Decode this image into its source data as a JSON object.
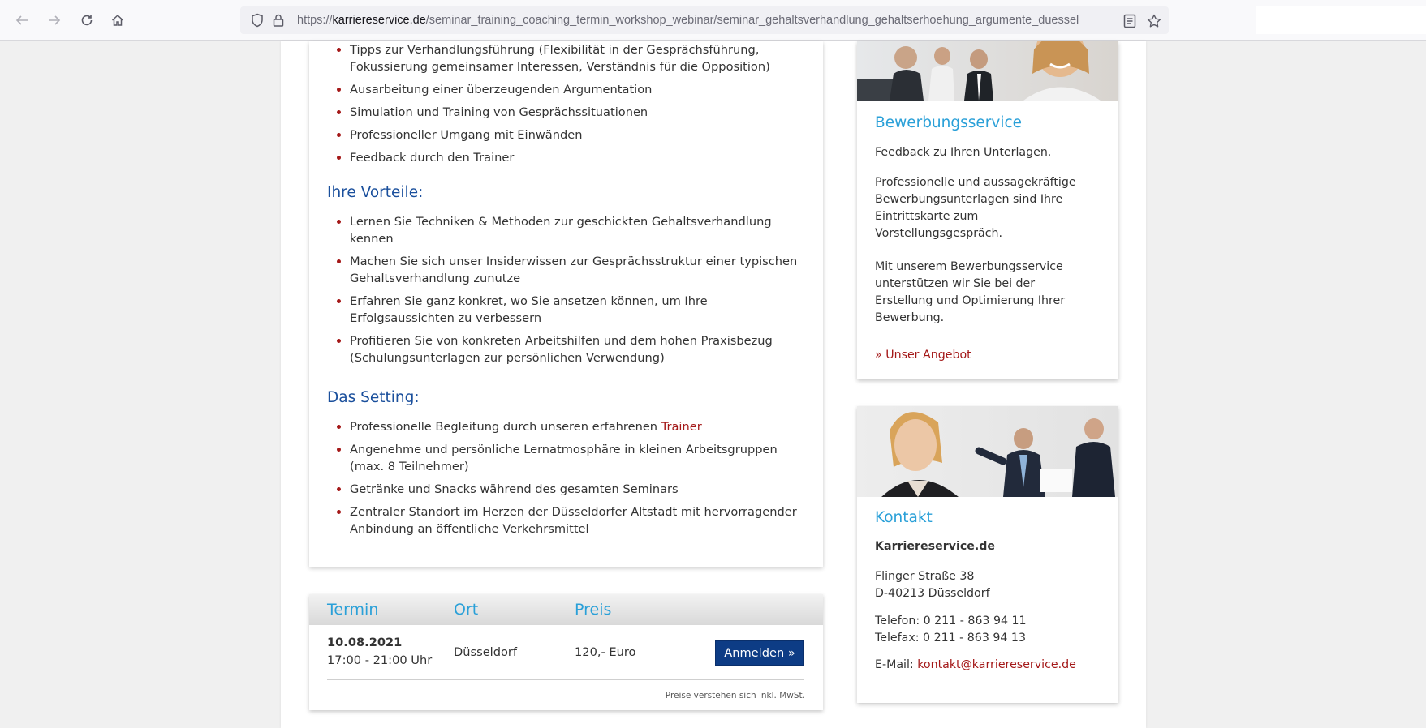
{
  "browser": {
    "url_prefix": "https://",
    "url_domain": "karriereservice.de",
    "url_path": "/seminar_training_coaching_termin_workshop_webinar/seminar_gehaltsverhandlung_gehaltserhoehung_argumente_duessel"
  },
  "main": {
    "intro_items": [
      {
        "line1": "Tipps zur Verhandlungsführung (Flexibilität in der Gesprächsführung,",
        "line2": "Fokussierung gemeinsamer Interessen, Verständnis für die Opposition)"
      },
      {
        "line1": "Ausarbeitung einer überzeugenden Argumentation"
      },
      {
        "line1": "Simulation und Training von Gesprächssituationen"
      },
      {
        "line1": "Professioneller Umgang mit Einwänden"
      },
      {
        "line1": "Feedback durch den Trainer"
      }
    ],
    "vorteile_heading": "Ihre Vorteile:",
    "vorteile_items": [
      {
        "line1": "Lernen Sie Techniken & Methoden zur geschickten Gehaltsverhandlung",
        "line2": "kennen"
      },
      {
        "line1": "Machen Sie sich unser Insiderwissen zur Gesprächsstruktur einer typischen",
        "line2": "Gehaltsverhandlung zunutze"
      },
      {
        "line1": "Erfahren Sie ganz konkret, wo Sie ansetzen können, um Ihre",
        "line2": "Erfolgsaussichten zu verbessern"
      },
      {
        "line1": "Profitieren Sie von konkreten Arbeitshilfen und dem hohen Praxisbezug",
        "line2": "(Schulungsunterlagen zur persönlichen Verwendung)"
      }
    ],
    "setting_heading": "Das Setting:",
    "setting_item1_text": "Professionelle Begleitung durch unseren erfahrenen ",
    "setting_item1_link": "Trainer",
    "setting_items": [
      {
        "line1": "Angenehme und persönliche Lernatmosphäre in kleinen Arbeitsgruppen",
        "line2": "(max. 8 Teilnehmer)"
      },
      {
        "line1": "Getränke und Snacks während des gesamten Seminars"
      },
      {
        "line1": "Zentraler Standort im Herzen der Düsseldorfer Altstadt mit hervorragender",
        "line2": "Anbindung an öffentliche Verkehrsmittel"
      }
    ]
  },
  "termin": {
    "col_termin": "Termin",
    "col_ort": "Ort",
    "col_preis": "Preis",
    "date": "10.08.2021",
    "time": "17:00 - 21:00 Uhr",
    "ort": "Düsseldorf",
    "preis": "120,- Euro",
    "button": "Anmelden  »",
    "note": "Preise verstehen sich inkl. MwSt."
  },
  "bewerbung": {
    "title": "Bewerbungsservice",
    "p1": "Feedback zu Ihren Unterlagen.",
    "p2_l1": "Professionelle und aussagekräftige",
    "p2_l2": "Bewerbungsunterlagen sind Ihre",
    "p2_l3": "Eintrittskarte zum",
    "p2_l4": "Vorstellungsgespräch.",
    "p3_l1": "Mit unserem Bewerbungsservice",
    "p3_l2": "unterstützen wir Sie bei der",
    "p3_l3": "Erstellung und Optimierung Ihrer",
    "p3_l4": "Bewerbung.",
    "link": "» Unser Angebot"
  },
  "kontakt": {
    "title": "Kontakt",
    "company": "Karriereservice.de",
    "street": "Flinger Straße 38",
    "city": "D-40213 Düsseldorf",
    "phone": "Telefon: 0 211 - 863 94 11",
    "fax": "Telefax: 0 211 - 863 94 13",
    "email_label": "E-Mail: ",
    "email": "kontakt@karriereservice.de"
  },
  "colors": {
    "heading_blue": "#1a4f9c",
    "accent_cyan": "#2aa0d8",
    "link_red": "#a41818",
    "button_navy": "#0d3c85"
  },
  "icons": [
    "back-arrow-icon",
    "forward-arrow-icon",
    "reload-icon",
    "home-icon",
    "shield-icon",
    "lock-icon",
    "reader-view-icon",
    "bookmark-star-icon"
  ]
}
